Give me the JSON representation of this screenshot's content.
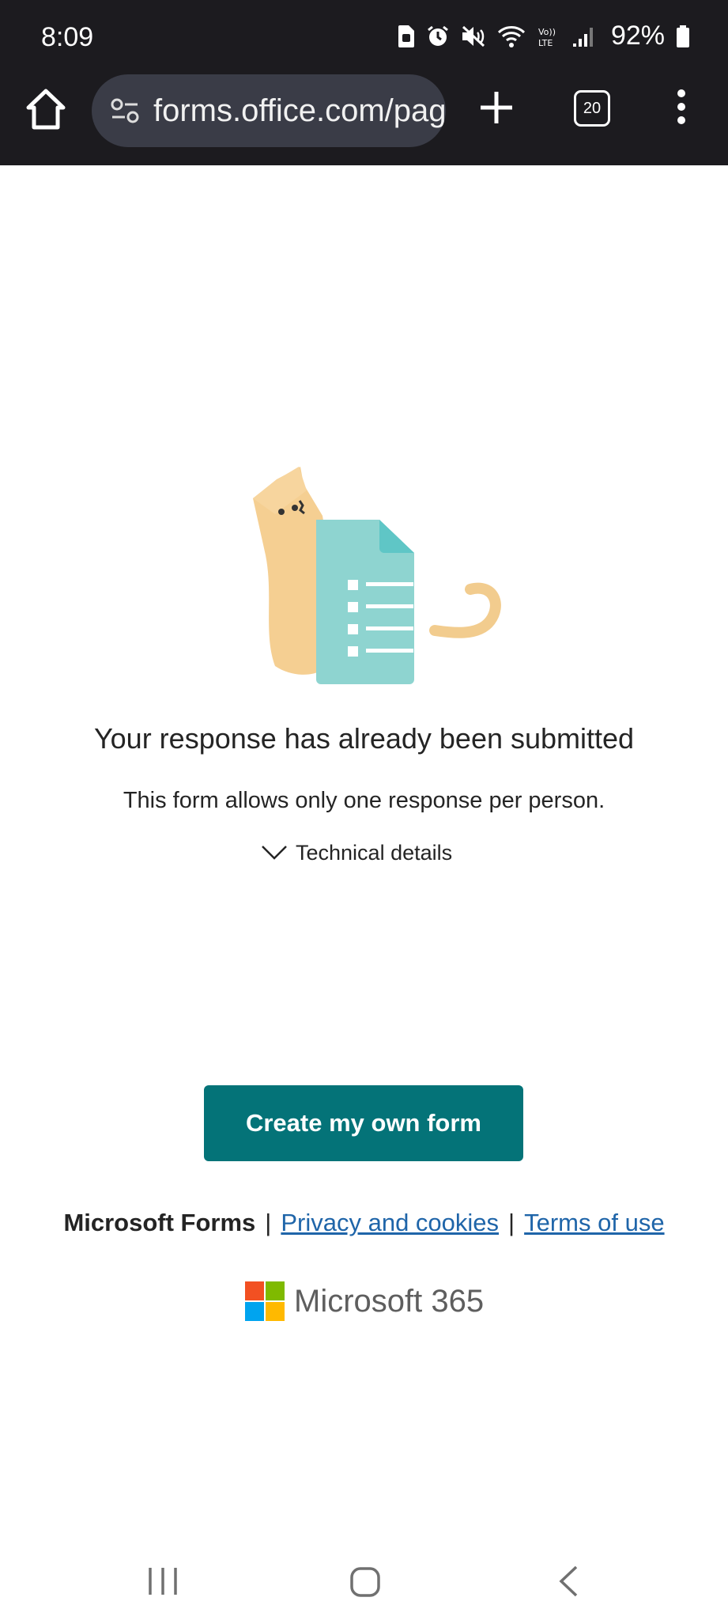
{
  "status_bar": {
    "time": "8:09",
    "battery_percent": "92%",
    "icons": [
      "sim-icon",
      "alarm-icon",
      "mute-icon",
      "wifi-icon",
      "volte-icon",
      "signal-icon",
      "battery-icon"
    ],
    "volte_label": "Vo)) LTE"
  },
  "browser": {
    "url": "forms.office.com/pages",
    "tab_count": "20",
    "icons": [
      "home-icon",
      "site-settings-icon",
      "new-tab-icon",
      "overflow-menu-icon"
    ]
  },
  "message": {
    "title": "Your response has already been submitted",
    "subtitle": "This form allows only one response per person.",
    "details_toggle": "Technical details"
  },
  "actions": {
    "create_form": "Create my own form"
  },
  "footer": {
    "brand": "Microsoft Forms",
    "privacy_link": "Privacy and cookies",
    "terms_link": "Terms of use",
    "separator": "|",
    "logo_text": "Microsoft 365",
    "logo_colors": [
      "#f25022",
      "#7fba00",
      "#00a4ef",
      "#ffb900"
    ]
  },
  "colors": {
    "accent": "#047378",
    "link": "#1f65a9",
    "browser_bar": "#1c1b1f"
  },
  "system_nav": {
    "icons": [
      "recents-icon",
      "home-nav-icon",
      "back-icon"
    ]
  }
}
